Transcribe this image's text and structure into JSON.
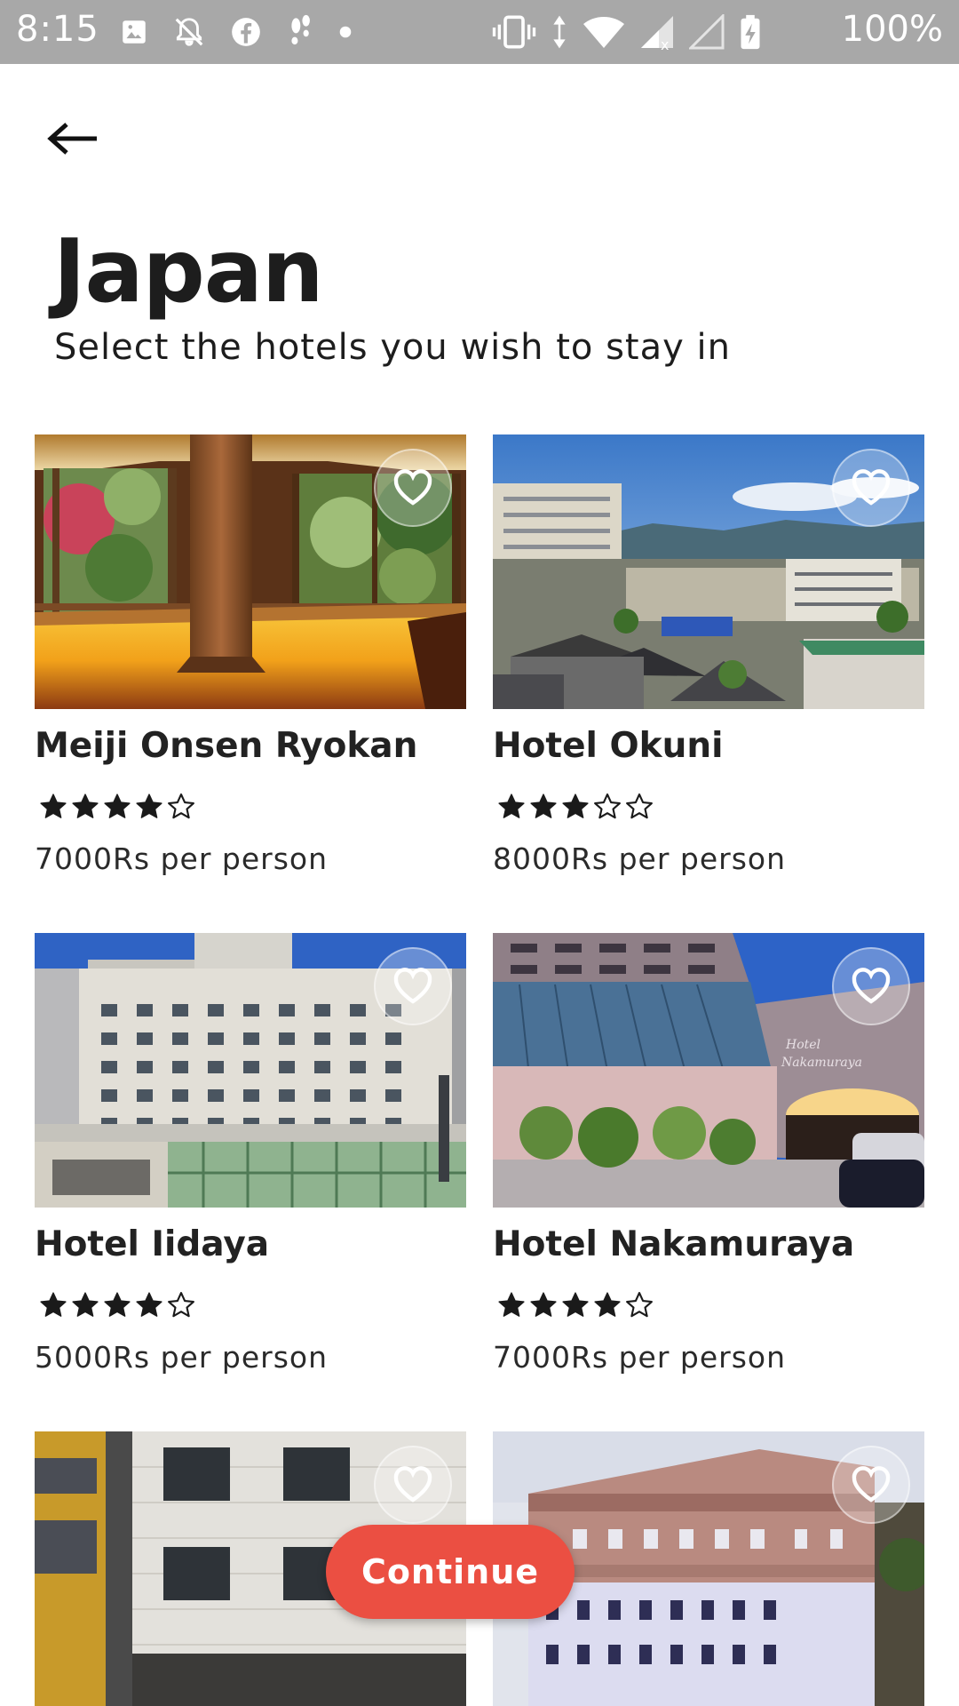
{
  "status_bar": {
    "time": "8:15",
    "battery": "100%",
    "left_icons": [
      "image-icon",
      "notifications-off-icon",
      "facebook-icon",
      "steps-icon",
      "dot-icon"
    ],
    "right_icons": [
      "vibrate-icon",
      "data-arrows-icon",
      "wifi-icon",
      "signal-icon",
      "signal-empty-icon",
      "battery-charging-icon"
    ]
  },
  "header": {
    "back_icon": "arrow-left-icon",
    "title": "Japan",
    "subtitle": "Select the hotels you wish to stay in"
  },
  "hotels": [
    {
      "name": "Meiji Onsen Ryokan",
      "rating": 4,
      "max_rating": 5,
      "price": "7000Rs per person",
      "favorite_icon": "heart-outline-icon"
    },
    {
      "name": "Hotel Okuni",
      "rating": 3,
      "max_rating": 5,
      "price": "8000Rs per person",
      "favorite_icon": "heart-outline-icon"
    },
    {
      "name": "Hotel Iidaya",
      "rating": 4,
      "max_rating": 5,
      "price": "5000Rs per person",
      "favorite_icon": "heart-outline-icon"
    },
    {
      "name": "Hotel Nakamuraya",
      "rating": 4,
      "max_rating": 5,
      "price": "7000Rs per person",
      "favorite_icon": "heart-outline-icon"
    },
    {
      "favorite_icon": "heart-outline-icon"
    },
    {
      "favorite_icon": "heart-outline-icon"
    }
  ],
  "continue_label": "Continue",
  "colors": {
    "status_bar_bg": "#a8a8a8",
    "accent": "#eb4f42",
    "text_primary": "#1d1d1d",
    "background": "#ffffff"
  }
}
